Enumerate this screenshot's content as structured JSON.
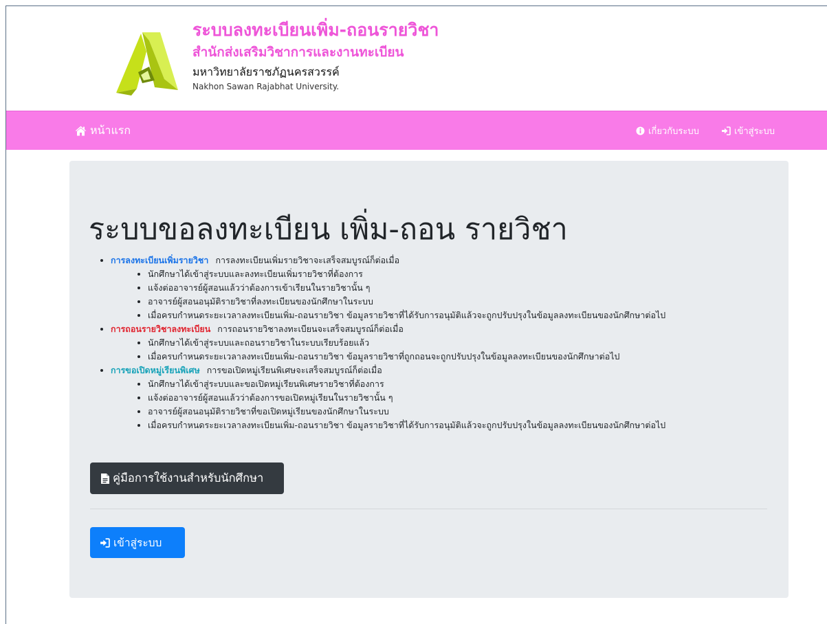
{
  "header": {
    "title": "ระบบลงทะเบียนเพิ่ม-ถอนรายวิชา",
    "office": "สำนักส่งเสริมวิชาการและงานทะเบียน",
    "university_th": "มหาวิทยาลัยราชภัฏนครสวรรค์",
    "university_en": "Nakhon Sawan Rajabhat University.",
    "logo_color": "#c6e01a",
    "brand_color": "#ee55d8"
  },
  "navbar": {
    "background": "#f97be8",
    "home_label": "หน้าแรก",
    "home_icon": "home-icon",
    "about_label": "เกี่ยวกับระบบ",
    "about_icon": "info-circle-icon",
    "login_label": "เข้าสู่ระบบ",
    "login_icon": "sign-in-icon"
  },
  "main": {
    "heading": "ระบบขอลงทะเบียน เพิ่ม-ถอน รายวิชา",
    "sections": [
      {
        "title": "การลงทะเบียนเพิ่มรายวิชา",
        "description": "การลงทะเบียนเพิ่มรายวิชาจะเสร็จสมบูรณ์ก็ต่อเมื่อ",
        "color": "#1a73e8",
        "steps": [
          "นักศึกษาได้เข้าสู่ระบบและลงทะเบียนเพิ่มรายวิชาที่ต้องการ",
          "แจ้งต่ออาจารย์ผู้สอนแล้วว่าต้องการเข้าเรียนในรายวิชานั้น ๆ",
          "อาจารย์ผู้สอนอนุมัติรายวิชาที่ลงทะเบียนของนักศึกษาในระบบ",
          "เมื่อครบกำหนดระยะเวลาลงทะเบียนเพิ่ม-ถอนรายวิชา ข้อมูลรายวิชาที่ได้รับการอนุมัติแล้วจะถูกปรับปรุงในข้อมูลลงทะเบียนของนักศึกษาต่อไป"
        ]
      },
      {
        "title": "การถอนรายวิชาลงทะเบียน",
        "description": "การถอนรายวิชาลงทะเบียนจะเสร็จสมบูรณ์ก็ต่อเมื่อ",
        "color": "#e0242f",
        "steps": [
          "นักศึกษาได้เข้าสู่ระบบและถอนรายวิชาในระบบเรียบร้อยแล้ว",
          "เมื่อครบกำหนดระยะเวลาลงทะเบียนเพิ่ม-ถอนรายวิชา ข้อมูลรายวิชาที่ถูกถอนจะถูกปรับปรุงในข้อมูลลงทะเบียนของนักศึกษาต่อไป"
        ]
      },
      {
        "title": "การขอเปิดหมู่เรียนพิเศษ",
        "description": "การขอเปิดหมู่เรียนพิเศษจะเสร็จสมบูรณ์ก็ต่อเมื่อ",
        "color": "#17a2b8",
        "steps": [
          "นักศึกษาได้เข้าสู่ระบบและขอเปิดหมู่เรียนพิเศษรายวิชาที่ต้องการ",
          "แจ้งต่ออาจารย์ผู้สอนแล้วว่าต้องการขอเปิดหมู่เรียนในรายวิชานั้น ๆ",
          "อาจารย์ผู้สอนอนุมัติรายวิชาที่ขอเปิดหมู่เรียนของนักศึกษาในระบบ",
          "เมื่อครบกำหนดระยะเวลาลงทะเบียนเพิ่ม-ถอนรายวิชา ข้อมูลรายวิชาที่ได้รับการอนุมัติแล้วจะถูกปรับปรุงในข้อมูลลงทะเบียนของนักศึกษาต่อไป"
        ]
      }
    ],
    "manual_button": {
      "label": "คู่มือการใช้งานสำหรับนักศึกษา",
      "icon": "file-icon",
      "color": "#343a40"
    },
    "login_button": {
      "label": "เข้าสู่ระบบ",
      "icon": "sign-in-icon",
      "color": "#0d7ffb"
    }
  }
}
